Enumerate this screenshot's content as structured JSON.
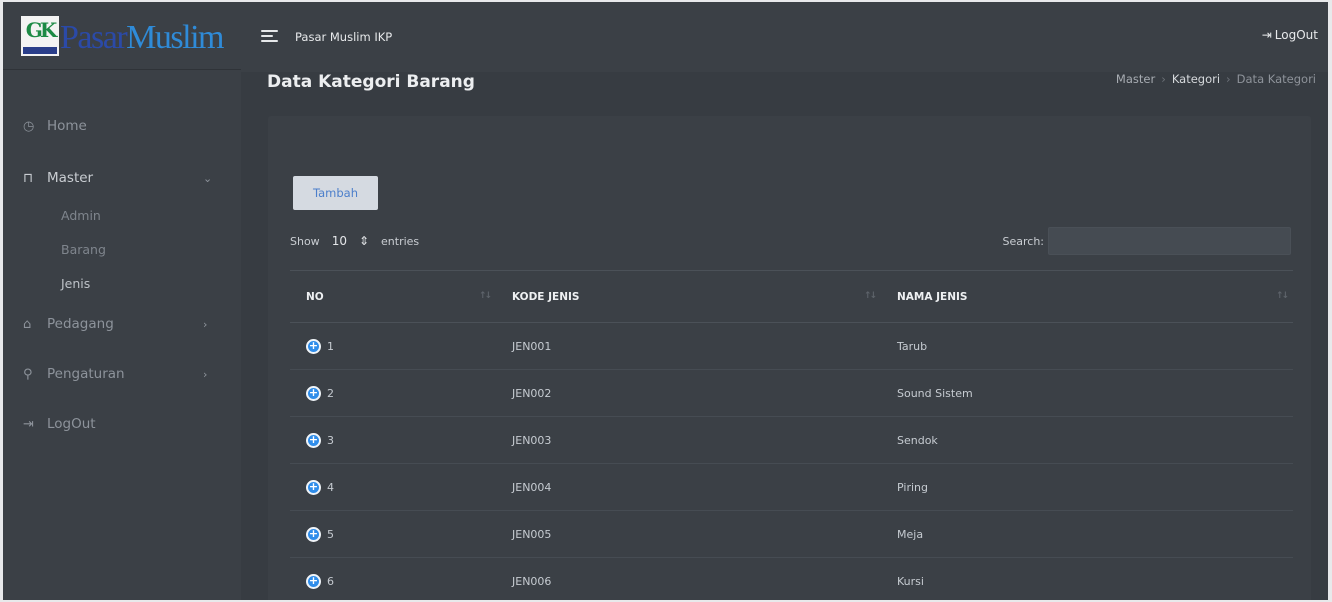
{
  "brand": {
    "text_a": "Pasar",
    "text_b": "Muslim",
    "emblem": "GK"
  },
  "sidebar": {
    "items": [
      {
        "label": "Home",
        "icon": "dashboard-icon"
      },
      {
        "label": "Master",
        "icon": "building-icon"
      },
      {
        "label": "Pedagang",
        "icon": "trader-icon"
      },
      {
        "label": "Pengaturan",
        "icon": "settings-icon"
      },
      {
        "label": "LogOut",
        "icon": "logout-icon"
      }
    ],
    "master_sub": [
      "Admin",
      "Barang",
      "Jenis"
    ]
  },
  "topbar": {
    "title": "Pasar Muslim IKP",
    "logout": "LogOut"
  },
  "page": {
    "title": "Data Kategori Barang"
  },
  "breadcrumb": [
    "Master",
    "Kategori",
    "Data Kategori"
  ],
  "card": {
    "add_button": "Tambah",
    "length_show": "Show",
    "length_value": "10",
    "length_entries": "entries",
    "search_label": "Search:",
    "search_placeholder": ""
  },
  "table": {
    "columns": [
      "NO",
      "KODE JENIS",
      "NAMA JENIS"
    ],
    "rows": [
      {
        "no": "1",
        "kode": "JEN001",
        "nama": "Tarub"
      },
      {
        "no": "2",
        "kode": "JEN002",
        "nama": "Sound Sistem"
      },
      {
        "no": "3",
        "kode": "JEN003",
        "nama": "Sendok"
      },
      {
        "no": "4",
        "kode": "JEN004",
        "nama": "Piring"
      },
      {
        "no": "5",
        "kode": "JEN005",
        "nama": "Meja"
      },
      {
        "no": "6",
        "kode": "JEN006",
        "nama": "Kursi"
      }
    ]
  }
}
